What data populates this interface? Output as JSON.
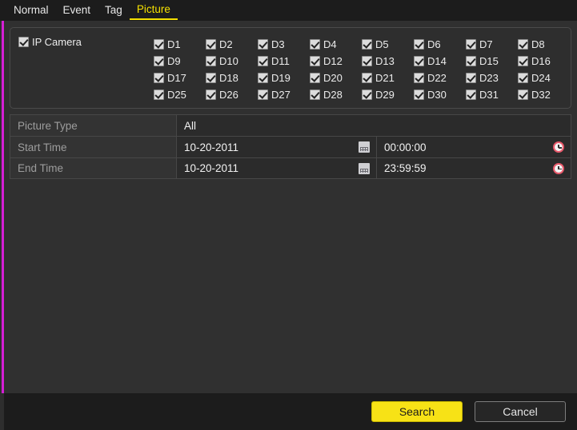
{
  "tabs": [
    {
      "label": "Normal",
      "active": false
    },
    {
      "label": "Event",
      "active": false
    },
    {
      "label": "Tag",
      "active": false
    },
    {
      "label": "Picture",
      "active": true
    }
  ],
  "camera_group": {
    "ip_camera_label": "IP Camera",
    "ip_camera_checked": true,
    "channels": [
      {
        "label": "D1",
        "checked": true
      },
      {
        "label": "D2",
        "checked": true
      },
      {
        "label": "D3",
        "checked": true
      },
      {
        "label": "D4",
        "checked": true
      },
      {
        "label": "D5",
        "checked": true
      },
      {
        "label": "D6",
        "checked": true
      },
      {
        "label": "D7",
        "checked": true
      },
      {
        "label": "D8",
        "checked": true
      },
      {
        "label": "D9",
        "checked": true
      },
      {
        "label": "D10",
        "checked": true
      },
      {
        "label": "D11",
        "checked": true
      },
      {
        "label": "D12",
        "checked": true
      },
      {
        "label": "D13",
        "checked": true
      },
      {
        "label": "D14",
        "checked": true
      },
      {
        "label": "D15",
        "checked": true
      },
      {
        "label": "D16",
        "checked": true
      },
      {
        "label": "D17",
        "checked": true
      },
      {
        "label": "D18",
        "checked": true
      },
      {
        "label": "D19",
        "checked": true
      },
      {
        "label": "D20",
        "checked": true
      },
      {
        "label": "D21",
        "checked": true
      },
      {
        "label": "D22",
        "checked": true
      },
      {
        "label": "D23",
        "checked": true
      },
      {
        "label": "D24",
        "checked": true
      },
      {
        "label": "D25",
        "checked": true
      },
      {
        "label": "D26",
        "checked": true
      },
      {
        "label": "D27",
        "checked": true
      },
      {
        "label": "D28",
        "checked": true
      },
      {
        "label": "D29",
        "checked": true
      },
      {
        "label": "D30",
        "checked": true
      },
      {
        "label": "D31",
        "checked": true
      },
      {
        "label": "D32",
        "checked": true
      }
    ]
  },
  "form": {
    "picture_type": {
      "label": "Picture Type",
      "value": "All"
    },
    "start_time": {
      "label": "Start Time",
      "date": "10-20-2011",
      "time": "00:00:00"
    },
    "end_time": {
      "label": "End Time",
      "date": "10-20-2011",
      "time": "23:59:59"
    }
  },
  "buttons": {
    "search": "Search",
    "cancel": "Cancel"
  },
  "colors": {
    "accent": "#d51fd5",
    "active_tab": "#f5e000",
    "primary_button": "#f7e216",
    "panel": "#303030",
    "bar": "#1c1c1c"
  }
}
